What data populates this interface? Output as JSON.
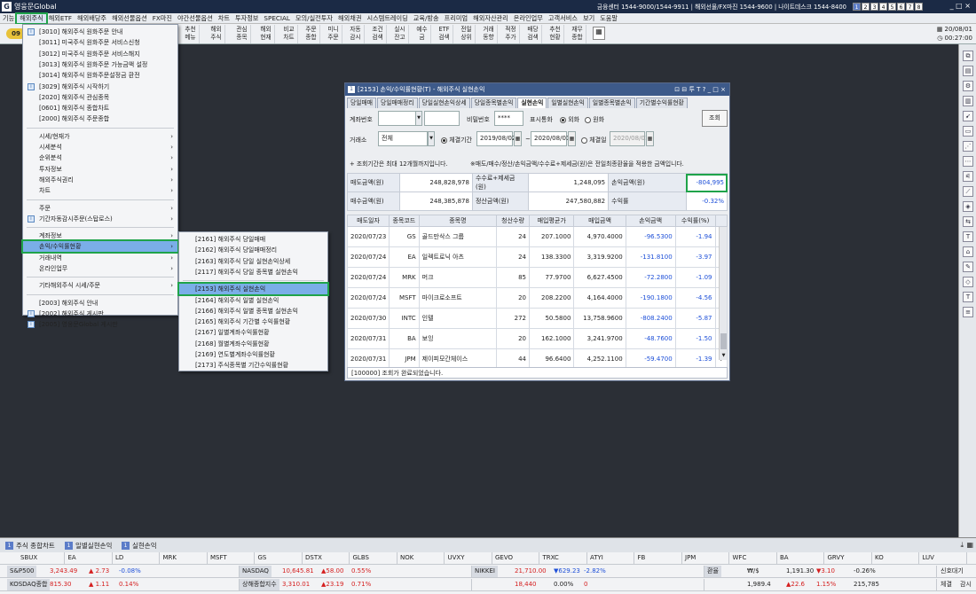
{
  "app": {
    "title": "영웅문Global",
    "logo": "G"
  },
  "titlebar": {
    "right_text": "금융센터 1544-9000/1544-9911 | 해외선물/FX마진 1544-9600 | 나이트데스크 1544-8400",
    "pages": [
      "1",
      "2",
      "3",
      "4",
      "5",
      "6",
      "7",
      "8"
    ],
    "active_page": "1"
  },
  "menubar": [
    "기능",
    "해외주식",
    "해외ETF",
    "해외배당주",
    "해외선물옵션",
    "FX마진",
    "야간선물옵션",
    "차트",
    "투자정보",
    "SPECIAL",
    "모의/실전투자",
    "해외채권",
    "시스템트레이딩",
    "교육/방송",
    "프리미엄",
    "해외자산관리",
    "온라인업무",
    "고객서비스",
    "보기",
    "도움말"
  ],
  "menubar_selected": "해외주식",
  "toolbar": {
    "buttons": [
      {
        "l1": "추천",
        "l2": "메뉴"
      },
      {
        "l1": "해외",
        "l2": "주식"
      },
      {
        "l1": "관심",
        "l2": "종목"
      },
      {
        "l1": "해외",
        "l2": "현재"
      },
      {
        "l1": "비교",
        "l2": "차트"
      },
      {
        "l1": "주문",
        "l2": "종합"
      },
      {
        "l1": "미니",
        "l2": "주문"
      },
      {
        "l1": "자동",
        "l2": "감시"
      },
      {
        "l1": "조건",
        "l2": "검색"
      },
      {
        "l1": "실시",
        "l2": "잔고"
      },
      {
        "l1": "예수",
        "l2": "금"
      },
      {
        "l1": "ETF",
        "l2": "검색"
      },
      {
        "l1": "전일",
        "l2": "상위"
      },
      {
        "l1": "거래",
        "l2": "동향"
      },
      {
        "l1": "적정",
        "l2": "주가"
      },
      {
        "l1": "배당",
        "l2": "검색"
      },
      {
        "l1": "추천",
        "l2": "현황"
      },
      {
        "l1": "재무",
        "l2": "종합"
      }
    ],
    "date": "20/08/01",
    "time": "00:27:00",
    "left_badge": "09"
  },
  "menu1": {
    "items": [
      {
        "label": "[3010] 해외주식 원화주문 안내",
        "icon": true
      },
      {
        "label": "[3011] 미국주식 원화주문 서비스신청"
      },
      {
        "label": "[3012] 미국주식 원화주문 서비스해지"
      },
      {
        "label": "[3013] 해외주식 원화주문 가능금액 설정"
      },
      {
        "label": "[3014] 해외주식 원화주문설정금 환전"
      },
      {
        "label": "[3029] 해외주식 시작하기",
        "icon": true
      },
      {
        "label": "[2020] 해외주식 관심종목"
      },
      {
        "label": "[0601] 해외주식 종합차트"
      },
      {
        "label": "[2000] 해외주식 주문종합"
      },
      {
        "sep": true
      },
      {
        "label": "시세/현재가",
        "arrow": true
      },
      {
        "label": "시세분석",
        "arrow": true
      },
      {
        "label": "순위분석",
        "arrow": true
      },
      {
        "label": "투자정보",
        "arrow": true
      },
      {
        "label": "해외주식권리",
        "arrow": true
      },
      {
        "label": "차트",
        "arrow": true
      },
      {
        "sep": true
      },
      {
        "label": "주문",
        "arrow": true
      },
      {
        "label": "기간자동감시주문(스탑로스)",
        "arrow": true,
        "icon": true
      },
      {
        "sep": true
      },
      {
        "label": "계좌정보",
        "arrow": true
      },
      {
        "label": "손익/수익률현황",
        "arrow": true,
        "hl": true
      },
      {
        "label": "거래내역",
        "arrow": true
      },
      {
        "label": "온라인업무",
        "arrow": true
      },
      {
        "sep": true
      },
      {
        "label": "기타해외주식 시세/주문",
        "arrow": true
      },
      {
        "sep": true
      },
      {
        "label": "[2003] 해외주식 안내"
      },
      {
        "label": "[2002] 해외주식 게시판",
        "icon": true
      },
      {
        "label": "[2005] 영웅문Global 게시판",
        "icon": true
      }
    ]
  },
  "menu2": {
    "items": [
      {
        "label": "[2161] 해외주식 당일매매"
      },
      {
        "label": "[2162] 해외주식 당일매매정리"
      },
      {
        "label": "[2163] 해외주식 당일 실현손익상세"
      },
      {
        "label": "[2117] 해외주식 당일 종목별 실현손익"
      },
      {
        "sep": true
      },
      {
        "label": "[2153] 해외주식 실현손익",
        "hl": true
      },
      {
        "label": "[2164] 해외주식 일별 실현손익"
      },
      {
        "label": "[2166] 해외주식 일별 종목별 실현손익"
      },
      {
        "label": "[2165] 해외주식 기간별 수익률현황"
      },
      {
        "label": "[2167] 일별계좌수익률현황"
      },
      {
        "label": "[2168] 월별계좌수익률현황"
      },
      {
        "label": "[2169] 연도별계좌수익률현황"
      },
      {
        "label": "[2173] 주식종목별 기간수익률현황"
      }
    ]
  },
  "dialog": {
    "badge": "1",
    "title": "[2153] 손익/수익률현황(T) - 해외주식 실현손익",
    "controls": "⊡ ⊟ 투 T ? _ □ ×",
    "tabs": [
      "당일매매",
      "당일매매정리",
      "당일실현손익상세",
      "당일종목별손익",
      "실현손익",
      "일별실현손익",
      "일별종목별손익",
      "기간별수익률현황"
    ],
    "active_tab": "실현손익",
    "account_label": "계좌번호",
    "password_label": "비밀번호",
    "password_value": "****",
    "currency_label": "표시통화",
    "currency_opt1": "외화",
    "currency_opt2": "원화",
    "query_btn": "조회",
    "exchange_label": "거래소",
    "exchange_value": "전체",
    "period_opt1": "체결기간",
    "date_from": "2019/08/02",
    "date_sep": "~",
    "date_to": "2020/08/01",
    "period_opt2": "체결일",
    "date_single": "2020/08/01",
    "notice1": "+ 조회기간은 최대 12개월까지입니다.",
    "notice2": "※매도/매수/정산/손익금액/수수료+제세금(원)은 전일최종환율을 적용한 금액입니다.",
    "summary": {
      "sell_label": "매도금액(원)",
      "sell_value": "248,828,978",
      "fee_label": "수수료+제세금(원)",
      "fee_value": "1,248,095",
      "pnl_label": "손익금액(원)",
      "pnl_value": "-804,995",
      "buy_label": "매수금액(원)",
      "buy_value": "248,385,878",
      "settle_label": "정산금액(원)",
      "settle_value": "247,580,882",
      "rate_label": "수익률",
      "rate_value": "-0.32%"
    },
    "columns": [
      "매도일자",
      "종목코드",
      "종목명",
      "청산수량",
      "매입평균가",
      "매입금액",
      "손익금액",
      "수익률(%)",
      ""
    ],
    "rows": [
      {
        "date": "2020/07/23",
        "code": "GS",
        "name": "골드만삭스 그룹",
        "qty": "24",
        "avg": "207.1000",
        "amt": "4,970.4000",
        "pnl": "-96.5300",
        "rate": "-1.94",
        "x": "I"
      },
      {
        "date": "2020/07/24",
        "code": "EA",
        "name": "일렉트로닉 아츠",
        "qty": "24",
        "avg": "138.3300",
        "amt": "3,319.9200",
        "pnl": "-131.8100",
        "rate": "-3.97",
        "x": "I"
      },
      {
        "date": "2020/07/24",
        "code": "MRK",
        "name": "머크",
        "qty": "85",
        "avg": "77.9700",
        "amt": "6,627.4500",
        "pnl": "-72.2800",
        "rate": "-1.09",
        "x": "I"
      },
      {
        "date": "2020/07/24",
        "code": "MSFT",
        "name": "마이크로소프트",
        "qty": "20",
        "avg": "208.2200",
        "amt": "4,164.4000",
        "pnl": "-190.1800",
        "rate": "-4.56",
        "x": "I"
      },
      {
        "date": "2020/07/30",
        "code": "INTC",
        "name": "인텔",
        "qty": "272",
        "avg": "50.5800",
        "amt": "13,758.9600",
        "pnl": "-808.2400",
        "rate": "-5.87",
        "x": "I"
      },
      {
        "date": "2020/07/31",
        "code": "BA",
        "name": "보잉",
        "qty": "20",
        "avg": "162.1000",
        "amt": "3,241.9700",
        "pnl": "-48.7600",
        "rate": "-1.50",
        "x": "I"
      },
      {
        "date": "2020/07/31",
        "code": "JPM",
        "name": "제이피모간체이스",
        "qty": "44",
        "avg": "96.6400",
        "amt": "4,252.1100",
        "pnl": "-59.4700",
        "rate": "-1.39",
        "x": "I"
      }
    ],
    "status": "[100000] 조회가 완료되었습니다."
  },
  "taskbar": [
    {
      "badge": "1",
      "label": "주식 종합차트"
    },
    {
      "badge": "1",
      "label": "일별실현손익"
    },
    {
      "badge": "1",
      "label": "실현손익"
    }
  ],
  "ticker_row1": [
    "SBUX",
    "EA",
    "LD",
    "MRK",
    "MSFT",
    "GS",
    "DSTX",
    "GLBS",
    "NOK",
    "UVXY",
    "GEVO",
    "TRXC",
    "ATYI",
    "FB",
    "JPM",
    "WFC",
    "BA",
    "GRVY",
    "KO",
    "LUV"
  ],
  "ticker_row2": [
    {
      "name": "S&P500",
      "v1": "3,243.49",
      "v2": "▲ 2.73",
      "v3": "-0.08%"
    },
    {
      "name": "NASDAQ",
      "v1": "10,645.81",
      "v2": "▲58.00",
      "v3": "0.55%"
    },
    {
      "name": "NIKKEI",
      "v1": "21,710.00",
      "v2": "▼629.23",
      "v3": "-2.82%"
    },
    {
      "name": "환율",
      "v1": "₩/$",
      "v2": "1,191.30",
      "v3": "▼3.10",
      "v4": "-0.26%"
    }
  ],
  "ticker_row3": [
    {
      "name": "KOSDAQ종합",
      "v1": "815.30",
      "v2": "▲ 1.11",
      "v3": "0.14%"
    },
    {
      "name": "상해종합지수",
      "v1": "3,310.01",
      "v2": "▲23.19",
      "v3": "0.71%"
    },
    {
      "name": "",
      "v1": "18,440",
      "v2": "0.00%",
      "v3": "0"
    },
    {
      "name": "",
      "v1": "1,989.4",
      "v2": "▲22.6",
      "v3": "1.15%",
      "v4": "215,785"
    }
  ],
  "ticker_right": {
    "r1": "신호대기",
    "r2a": "체결",
    "r2b": "감시"
  }
}
